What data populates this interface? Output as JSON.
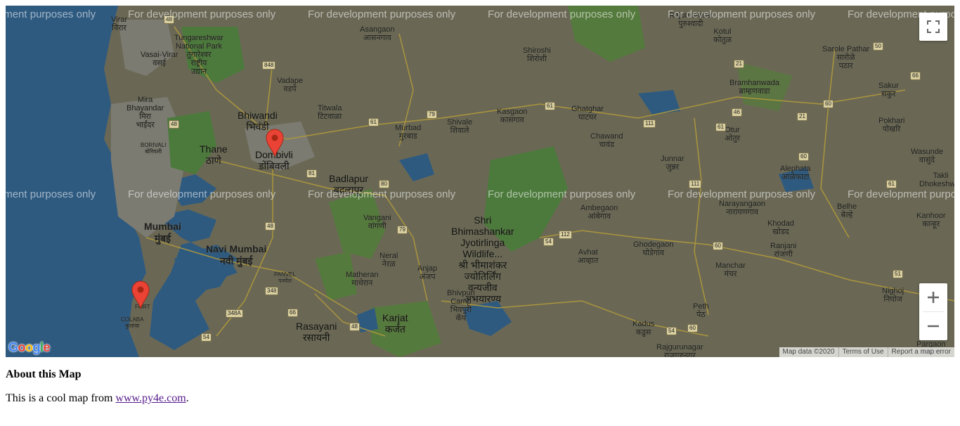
{
  "map": {
    "watermark": "For development purposes only",
    "labels": [
      {
        "text": "Virar\nविरार",
        "kind": "small"
      },
      {
        "text": "Tungareshwar\nNational Park\nतुंगारेश्वर\nराष्ट्रीय\nउद्यान",
        "kind": "small"
      },
      {
        "text": "Vasai-Virar\nवसई",
        "kind": "small"
      },
      {
        "text": "Mira\nBhayandar\nमिरा\nभाईंदर",
        "kind": "small"
      },
      {
        "text": "BORIVALI\nबोरिवली",
        "kind": "tiny"
      },
      {
        "text": "Thane\nठाणे",
        "kind": "big"
      },
      {
        "text": "Bhiwandi\nभिवंडी",
        "kind": "big"
      },
      {
        "text": "Vadape\nवडपे",
        "kind": "small"
      },
      {
        "text": "Dombivli\nडोंबिवली",
        "kind": "big"
      },
      {
        "text": "Titwala\nटिटवाळा",
        "kind": "small"
      },
      {
        "text": "Asangaon\nआसनगाव",
        "kind": "small"
      },
      {
        "text": "Shiroshi\nशिरोशी",
        "kind": "small"
      },
      {
        "text": "Murbad\nमुरबाड",
        "kind": "small"
      },
      {
        "text": "Shivale\nशिवाले",
        "kind": "small"
      },
      {
        "text": "Kasgaon\nकासगाव",
        "kind": "small"
      },
      {
        "text": "Ghatghar\nघाटघर",
        "kind": "small"
      },
      {
        "text": "Chawand\nचावंड",
        "kind": "small"
      },
      {
        "text": "Kotul\nकोतुळ",
        "kind": "small"
      },
      {
        "text": "Rajurushwar\nपुरुश्वादी",
        "kind": "small"
      },
      {
        "text": "Sarole Pathar\nसारोळे\nपठार",
        "kind": "small"
      },
      {
        "text": "Bramhanwada\nब्राम्हणवाडा",
        "kind": "small"
      },
      {
        "text": "Sakur\nसकुर",
        "kind": "small"
      },
      {
        "text": "Otur\nओतुर",
        "kind": "small"
      },
      {
        "text": "Pokhari\nपोखरि",
        "kind": "small"
      },
      {
        "text": "Junnar\nजुन्नर",
        "kind": "small"
      },
      {
        "text": "Alephata\nआळेफाटा",
        "kind": "small"
      },
      {
        "text": "Wasunde\nवासुंदे",
        "kind": "small"
      },
      {
        "text": "Takli\nDhokeshwar",
        "kind": "small"
      },
      {
        "text": "Badlapur\nबदलापूर",
        "kind": "big"
      },
      {
        "text": "Mumbai\nमुंबई",
        "kind": "bold"
      },
      {
        "text": "Navi Mumbai\nनवी मुंबई",
        "kind": "bold"
      },
      {
        "text": "PANVEL\nपनवेल",
        "kind": "tiny"
      },
      {
        "text": "Vangani\nवांगणी",
        "kind": "small"
      },
      {
        "text": "Neral\nनेरळ",
        "kind": "small"
      },
      {
        "text": "Matheran\nमाथेरान",
        "kind": "small"
      },
      {
        "text": "Anjap\nअंजप",
        "kind": "small"
      },
      {
        "text": "Karjat\nकर्जत",
        "kind": "big"
      },
      {
        "text": "Rasayani\nरसायनी",
        "kind": "big"
      },
      {
        "text": "COLABA\nकुलाबा",
        "kind": "tiny"
      },
      {
        "text": "FORT",
        "kind": "tiny"
      },
      {
        "text": "Shri\nBhimashankar\nJyotirlinga\nWildlife...\nश्री भीमाशंकर\nज्योतिर्लिंग\nवन्यजीव\nअभयारण्य",
        "kind": "big"
      },
      {
        "text": "Bhivpuri\nCamp\nभिवपुरी\nकॅंप",
        "kind": "small"
      },
      {
        "text": "Ambegaon\nआंबेगाव",
        "kind": "small"
      },
      {
        "text": "Avhat\nआव्हात",
        "kind": "small"
      },
      {
        "text": "Ghodegaon\nघोडेगाव",
        "kind": "small"
      },
      {
        "text": "Narayangaon\nनारायणगाव",
        "kind": "small"
      },
      {
        "text": "Khodad\nखोडद",
        "kind": "small"
      },
      {
        "text": "Ranjani\nरांजणी",
        "kind": "small"
      },
      {
        "text": "Belhe\nबेल्हे",
        "kind": "small"
      },
      {
        "text": "Kanhoor\nकान्हूर",
        "kind": "small"
      },
      {
        "text": "Manchar\nमंचर",
        "kind": "small"
      },
      {
        "text": "Peth\nपेठ",
        "kind": "small"
      },
      {
        "text": "Nighoj\nनिघोज",
        "kind": "small"
      },
      {
        "text": "Kadus\nकडुस",
        "kind": "small"
      },
      {
        "text": "Rajgurunagar\nराजगुरुनगर",
        "kind": "small"
      },
      {
        "text": "Pargaon\nपारगाव",
        "kind": "small"
      }
    ],
    "shields": [
      "48",
      "848",
      "79",
      "61",
      "61",
      "111",
      "21",
      "50",
      "66",
      "60",
      "46",
      "21",
      "61",
      "60",
      "111",
      "61",
      "80",
      "81",
      "48",
      "79",
      "54",
      "112",
      "60",
      "51",
      "348",
      "348A",
      "66",
      "54",
      "48",
      "54",
      "60",
      "48"
    ],
    "attribution": {
      "map_data": "Map data ©2020",
      "terms": "Terms of Use",
      "report": "Report a map error"
    },
    "logo": "Google",
    "fullscreen_icon": "fullscreen-icon",
    "zoom_in_icon": "plus-icon",
    "zoom_out_icon": "minus-icon",
    "marker_color": "#ea4335"
  },
  "about": {
    "heading": "About this Map",
    "text_before": "This is a cool map from ",
    "link_text": "www.py4e.com",
    "text_after": "."
  }
}
